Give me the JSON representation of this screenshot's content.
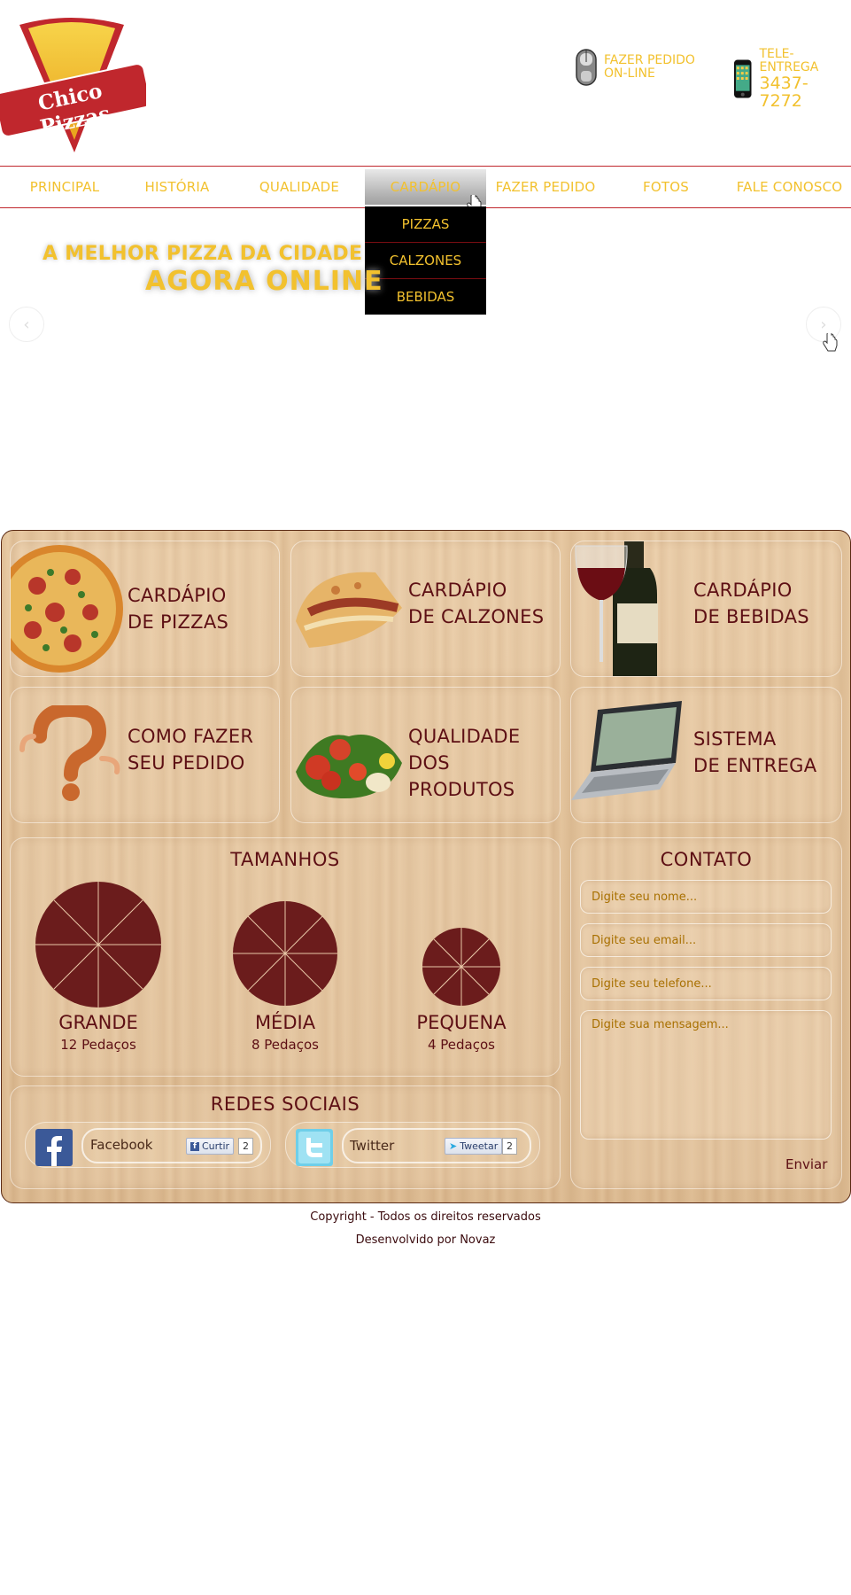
{
  "brand": {
    "name": "Chico Pizzas"
  },
  "header": {
    "order_online": {
      "line1": "FAZER PEDIDO",
      "line2": "ON-LINE"
    },
    "delivery": {
      "label": "TELE-ENTREGA",
      "phone": "3437-7272"
    }
  },
  "nav": {
    "items": [
      "PRINCIPAL",
      "HISTÓRIA",
      "QUALIDADE",
      "CARDÁPIO",
      "FAZER PEDIDO",
      "FOTOS",
      "FALE CONOSCO"
    ],
    "active": "CARDÁPIO",
    "dropdown": [
      "PIZZAS",
      "CALZONES",
      "BEBIDAS"
    ]
  },
  "banner": {
    "line1": "A MELHOR PIZZA DA CIDADE",
    "line2": "AGORA ONLINE"
  },
  "tiles": [
    {
      "line1": "CARDÁPIO",
      "line2": "DE PIZZAS"
    },
    {
      "line1": "CARDÁPIO",
      "line2": "DE CALZONES"
    },
    {
      "line1": "CARDÁPIO",
      "line2": "DE BEBIDAS"
    },
    {
      "line1": "COMO FAZER",
      "line2": "SEU PEDIDO"
    },
    {
      "line1": "QUALIDADE",
      "line2": "DOS PRODUTOS"
    },
    {
      "line1": "SISTEMA",
      "line2": "DE ENTREGA"
    }
  ],
  "sizes": {
    "title": "TAMANHOS",
    "items": [
      {
        "name": "GRANDE",
        "slices": "12 Pedaços"
      },
      {
        "name": "MÉDIA",
        "slices": "8 Pedaços"
      },
      {
        "name": "PEQUENA",
        "slices": "4 Pedaços"
      }
    ]
  },
  "social": {
    "title": "REDES SOCIAIS",
    "facebook": {
      "label": "Facebook",
      "button": "Curtir",
      "count": "2"
    },
    "twitter": {
      "label": "Twitter",
      "button": "Tweetar",
      "count": "2"
    }
  },
  "contact": {
    "title": "CONTATO",
    "name_placeholder": "Digite seu nome...",
    "email_placeholder": "Digite seu email...",
    "phone_placeholder": "Digite seu telefone...",
    "message_placeholder": "Digite sua mensagem...",
    "submit": "Enviar"
  },
  "footer": {
    "copyright": "Copyright - Todos os direitos reservados",
    "developer": "Desenvolvido por Novaz"
  },
  "colors": {
    "accent": "#f2c12e",
    "brand_red": "#c0272d",
    "text_dark": "#5d0f14",
    "pizza": "#6b1c1c"
  }
}
